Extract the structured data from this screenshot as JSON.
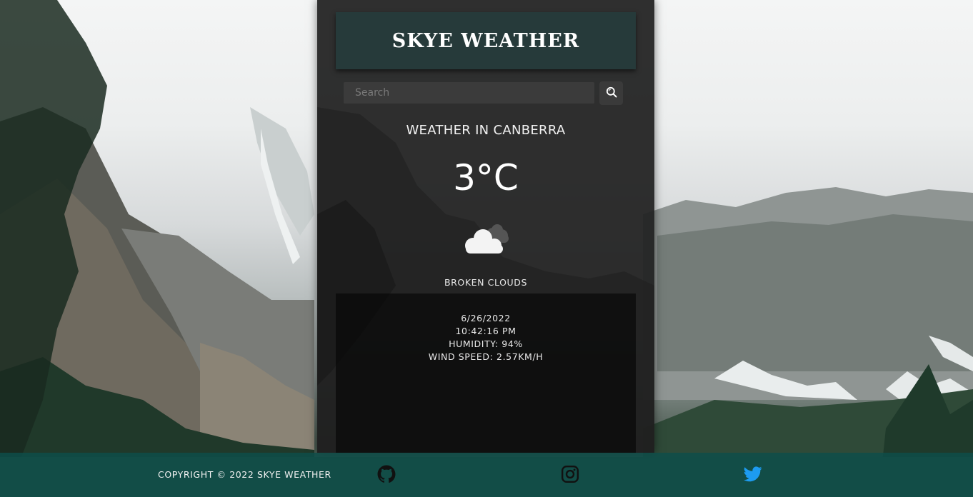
{
  "app": {
    "title": "SKYE WEATHER"
  },
  "search": {
    "placeholder": "Search",
    "value": "",
    "button_icon": "search-icon"
  },
  "weather": {
    "city_heading": "WEATHER IN CANBERRA",
    "temperature": "3°C",
    "icon": "broken-clouds-icon",
    "description": "BROKEN CLOUDS",
    "date": "6/26/2022",
    "time": "10:42:16 PM",
    "humidity": "HUMIDITY: 94%",
    "wind_speed": "WIND SPEED: 2.57KM/H"
  },
  "footer": {
    "copyright": "COPYRIGHT © 2022 SKYE WEATHER",
    "social": [
      {
        "name": "github-icon",
        "color": "#111111"
      },
      {
        "name": "instagram-icon",
        "color": "#111111"
      },
      {
        "name": "twitter-icon",
        "color": "#1d9bf0"
      }
    ]
  },
  "colors": {
    "header_bg": "#263a3a",
    "card_bg": "#222222",
    "footer_bg": "#0e4e4a",
    "accent_twitter": "#1d9bf0"
  }
}
